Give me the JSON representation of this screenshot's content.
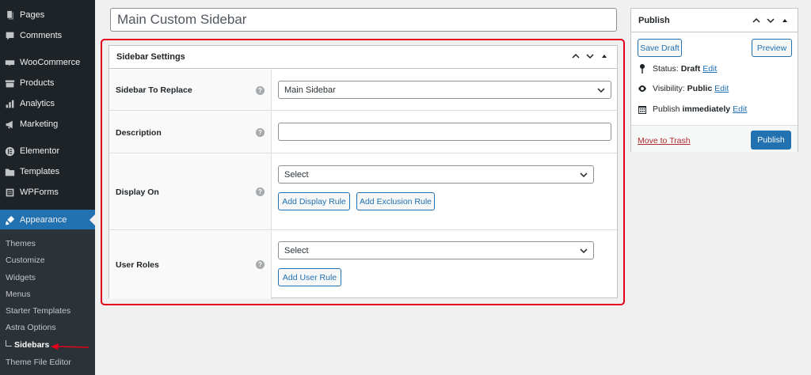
{
  "admin_menu": {
    "items": [
      {
        "label": "Pages",
        "icon": "pages-icon"
      },
      {
        "label": "Comments",
        "icon": "comments-icon"
      },
      {
        "label": "WooCommerce",
        "icon": "woocommerce-icon"
      },
      {
        "label": "Products",
        "icon": "products-icon"
      },
      {
        "label": "Analytics",
        "icon": "analytics-icon"
      },
      {
        "label": "Marketing",
        "icon": "megaphone-icon"
      },
      {
        "label": "Elementor",
        "icon": "elementor-icon"
      },
      {
        "label": "Templates",
        "icon": "folder-icon"
      },
      {
        "label": "WPForms",
        "icon": "wpforms-icon"
      },
      {
        "label": "Appearance",
        "icon": "paintbrush-icon"
      }
    ],
    "submenu": [
      "Themes",
      "Customize",
      "Widgets",
      "Menus",
      "Starter Templates",
      "Astra Options",
      "Sidebars",
      "Theme File Editor"
    ],
    "current_submenu": "Sidebars",
    "active_color": "#2271b1",
    "arrow_color": "#e3001b"
  },
  "title": {
    "value": "Main Custom Sidebar"
  },
  "settings": {
    "heading": "Sidebar Settings",
    "rows": {
      "replace": {
        "label": "Sidebar To Replace",
        "value": "Main Sidebar"
      },
      "description": {
        "label": "Description",
        "value": ""
      },
      "display_on": {
        "label": "Display On",
        "select": "Select",
        "add_display": "Add Display Rule",
        "add_exclusion": "Add Exclusion Rule"
      },
      "user_roles": {
        "label": "User Roles",
        "select": "Select",
        "add_user": "Add User Rule"
      }
    },
    "highlight_color": "#e3001b"
  },
  "publish": {
    "heading": "Publish",
    "save_draft": "Save Draft",
    "preview": "Preview",
    "status_label": "Status:",
    "status_value": "Draft",
    "visibility_label": "Visibility:",
    "visibility_value": "Public",
    "publish_label": "Publish",
    "publish_value": "immediately",
    "edit": "Edit",
    "trash": "Move to Trash",
    "publish_button": "Publish"
  }
}
